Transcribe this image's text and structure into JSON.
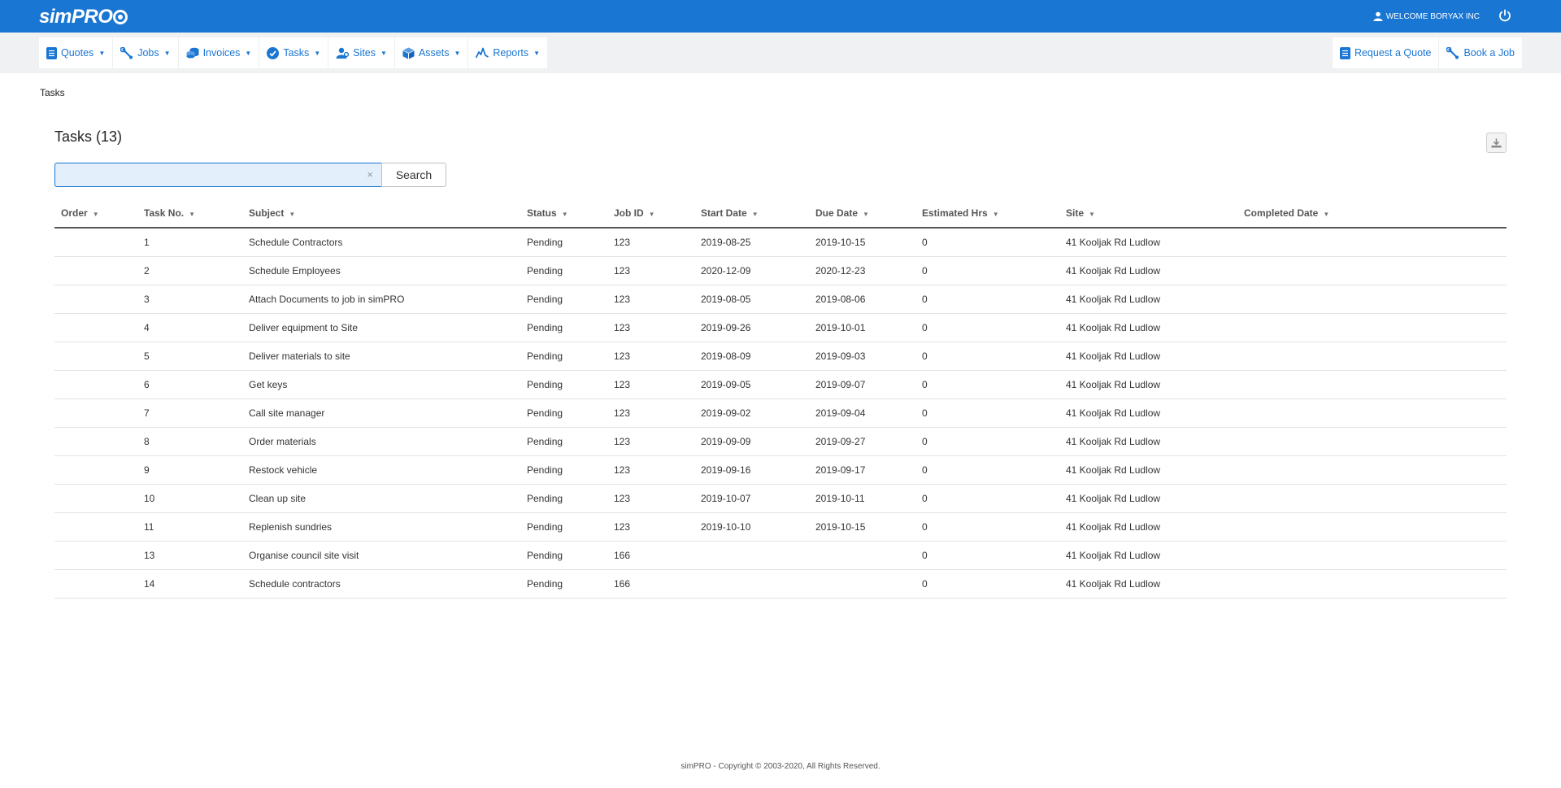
{
  "app": {
    "logo_text": "simPRO",
    "welcome_text": "WELCOME BORYAX INC"
  },
  "nav": {
    "left": [
      {
        "label": "Quotes",
        "icon": "document-icon"
      },
      {
        "label": "Jobs",
        "icon": "wrench-icon"
      },
      {
        "label": "Invoices",
        "icon": "coins-icon"
      },
      {
        "label": "Tasks",
        "icon": "check-circle-icon"
      },
      {
        "label": "Sites",
        "icon": "user-pin-icon"
      },
      {
        "label": "Assets",
        "icon": "cube-icon"
      },
      {
        "label": "Reports",
        "icon": "chart-line-icon"
      }
    ],
    "right": [
      {
        "label": "Request a Quote",
        "icon": "document-icon"
      },
      {
        "label": "Book a Job",
        "icon": "wrench-icon"
      }
    ]
  },
  "breadcrumb": "Tasks",
  "page_title": "Tasks (13)",
  "search": {
    "value": "",
    "clear_glyph": "×",
    "button_label": "Search"
  },
  "table": {
    "headers": [
      "Order",
      "Task No.",
      "Subject",
      "Status",
      "Job ID",
      "Start Date",
      "Due Date",
      "Estimated Hrs",
      "Site",
      "Completed Date"
    ],
    "rows": [
      {
        "order": "",
        "task_no": "1",
        "subject": "Schedule Contractors",
        "status": "Pending",
        "job_id": "123",
        "start": "2019-08-25",
        "due": "2019-10-15",
        "est": "0",
        "site": "41 Kooljak Rd Ludlow",
        "completed": ""
      },
      {
        "order": "",
        "task_no": "2",
        "subject": "Schedule Employees",
        "status": "Pending",
        "job_id": "123",
        "start": "2020-12-09",
        "due": "2020-12-23",
        "est": "0",
        "site": "41 Kooljak Rd Ludlow",
        "completed": ""
      },
      {
        "order": "",
        "task_no": "3",
        "subject": "Attach Documents to job in simPRO",
        "status": "Pending",
        "job_id": "123",
        "start": "2019-08-05",
        "due": "2019-08-06",
        "est": "0",
        "site": "41 Kooljak Rd Ludlow",
        "completed": ""
      },
      {
        "order": "",
        "task_no": "4",
        "subject": "Deliver equipment to Site",
        "status": "Pending",
        "job_id": "123",
        "start": "2019-09-26",
        "due": "2019-10-01",
        "est": "0",
        "site": "41 Kooljak Rd Ludlow",
        "completed": ""
      },
      {
        "order": "",
        "task_no": "5",
        "subject": "Deliver materials to site",
        "status": "Pending",
        "job_id": "123",
        "start": "2019-08-09",
        "due": "2019-09-03",
        "est": "0",
        "site": "41 Kooljak Rd Ludlow",
        "completed": ""
      },
      {
        "order": "",
        "task_no": "6",
        "subject": "Get keys",
        "status": "Pending",
        "job_id": "123",
        "start": "2019-09-05",
        "due": "2019-09-07",
        "est": "0",
        "site": "41 Kooljak Rd Ludlow",
        "completed": ""
      },
      {
        "order": "",
        "task_no": "7",
        "subject": "Call site manager",
        "status": "Pending",
        "job_id": "123",
        "start": "2019-09-02",
        "due": "2019-09-04",
        "est": "0",
        "site": "41 Kooljak Rd Ludlow",
        "completed": ""
      },
      {
        "order": "",
        "task_no": "8",
        "subject": "Order materials",
        "status": "Pending",
        "job_id": "123",
        "start": "2019-09-09",
        "due": "2019-09-27",
        "est": "0",
        "site": "41 Kooljak Rd Ludlow",
        "completed": ""
      },
      {
        "order": "",
        "task_no": "9",
        "subject": "Restock vehicle",
        "status": "Pending",
        "job_id": "123",
        "start": "2019-09-16",
        "due": "2019-09-17",
        "est": "0",
        "site": "41 Kooljak Rd Ludlow",
        "completed": ""
      },
      {
        "order": "",
        "task_no": "10",
        "subject": "Clean up site",
        "status": "Pending",
        "job_id": "123",
        "start": "2019-10-07",
        "due": "2019-10-11",
        "est": "0",
        "site": "41 Kooljak Rd Ludlow",
        "completed": ""
      },
      {
        "order": "",
        "task_no": "11",
        "subject": "Replenish sundries",
        "status": "Pending",
        "job_id": "123",
        "start": "2019-10-10",
        "due": "2019-10-15",
        "est": "0",
        "site": "41 Kooljak Rd Ludlow",
        "completed": ""
      },
      {
        "order": "",
        "task_no": "13",
        "subject": "Organise council site visit",
        "status": "Pending",
        "job_id": "166",
        "start": "",
        "due": "",
        "est": "0",
        "site": "41 Kooljak Rd Ludlow",
        "completed": ""
      },
      {
        "order": "",
        "task_no": "14",
        "subject": "Schedule contractors",
        "status": "Pending",
        "job_id": "166",
        "start": "",
        "due": "",
        "est": "0",
        "site": "41 Kooljak Rd Ludlow",
        "completed": ""
      }
    ]
  },
  "footer": "simPRO - Copyright © 2003-2020, All Rights Reserved.",
  "colors": {
    "brand_blue": "#1976d2",
    "nav_background": "#f0f1f2",
    "search_highlight": "#e3effa"
  }
}
